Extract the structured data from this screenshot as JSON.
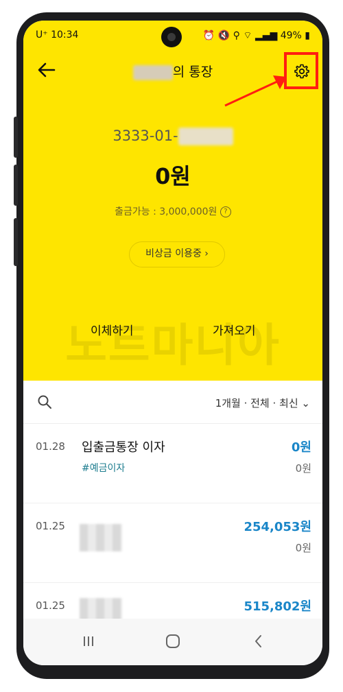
{
  "status": {
    "carrier": "U⁺",
    "time": "10:34",
    "battery": "49%"
  },
  "header": {
    "title_suffix": "의 통장"
  },
  "account": {
    "number_prefix": "3333-01-",
    "balance": "0원",
    "available": "출금가능 : 3,000,000원",
    "question_mark": "?",
    "emergency_button": "비상금 이용중 ›"
  },
  "actions": {
    "transfer": "이체하기",
    "import": "가져오기"
  },
  "watermark": "노트마니아",
  "list": {
    "filter": "1개월 · 전체 · 최신",
    "transactions": [
      {
        "date": "01.28",
        "name": "입출금통장 이자",
        "tag": "#예금이자",
        "amount": "0원",
        "balance": "0원"
      },
      {
        "date": "01.25",
        "name": "",
        "tag": "",
        "amount": "254,053원",
        "balance": "0원"
      },
      {
        "date": "01.25",
        "name": "",
        "tag": "",
        "amount": "515,802원",
        "balance": ""
      }
    ]
  },
  "colors": {
    "brand": "#FEE500",
    "highlight": "#FF1E10",
    "amount": "#1A86C8",
    "tag": "#1E7D8F"
  }
}
